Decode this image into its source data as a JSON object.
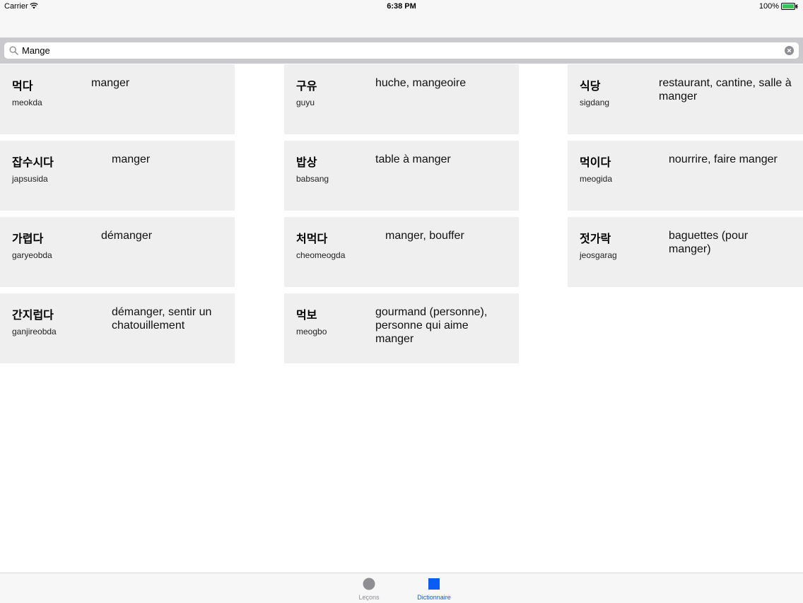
{
  "status_bar": {
    "carrier": "Carrier",
    "time": "6:38 PM",
    "battery": "100%",
    "icons": [
      "wifi-icon",
      "battery-icon"
    ]
  },
  "search": {
    "value": "Mange",
    "icons": [
      "search-icon",
      "clear-icon"
    ]
  },
  "results": [
    {
      "korean": "먹다",
      "roman": "meokda",
      "french": "manger"
    },
    {
      "korean": "구유",
      "roman": "guyu",
      "french": "huche, mangeoire"
    },
    {
      "korean": "식당",
      "roman": "sigdang",
      "french": "restaurant, cantine, salle à manger"
    },
    {
      "korean": "잡수시다",
      "roman": "japsusida",
      "french": "manger"
    },
    {
      "korean": "밥상",
      "roman": "babsang",
      "french": "table à manger"
    },
    {
      "korean": "먹이다",
      "roman": "meogida",
      "french": "nourrire, faire manger"
    },
    {
      "korean": "가렵다",
      "roman": "garyeobda",
      "french": "démanger"
    },
    {
      "korean": "처먹다",
      "roman": "cheomeogda",
      "french": "manger, bouffer"
    },
    {
      "korean": "젓가락",
      "roman": "jeosgarag",
      "french": "baguettes (pour manger)"
    },
    {
      "korean": "간지럽다",
      "roman": "ganjireobda",
      "french": "démanger, sentir un chatouillement"
    },
    {
      "korean": "먹보",
      "roman": "meogbo",
      "french": "gourmand (personne), personne qui aime manger"
    }
  ],
  "tabs": [
    {
      "label": "Leçons",
      "icon": "circle-icon",
      "selected": false
    },
    {
      "label": "Dictionnaire",
      "icon": "square-icon",
      "selected": true
    }
  ],
  "colors": {
    "accent": "#0a5cf5",
    "inactive": "#8e8e93",
    "card_bg": "#efeff0",
    "search_bg": "#c9c9ce"
  }
}
